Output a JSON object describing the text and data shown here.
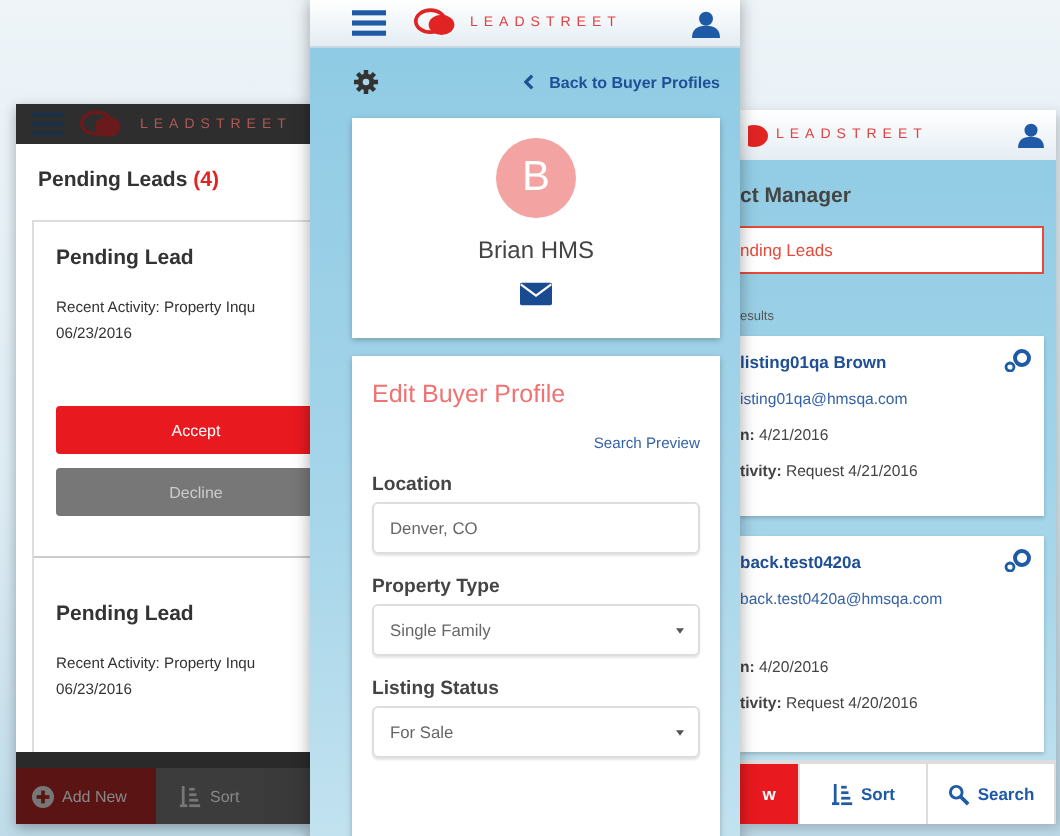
{
  "left_phone": {
    "logo": "LEADSTREET",
    "title": "Pending Leads",
    "count": "(4)",
    "leads": [
      {
        "heading": "Pending Lead",
        "activity": "Recent Activity: Property Inqu",
        "date": "06/23/2016",
        "accept": "Accept",
        "decline": "Decline"
      },
      {
        "heading": "Pending Lead",
        "activity": "Recent Activity: Property Inqu",
        "date": "06/23/2016"
      }
    ],
    "bottom_bar": [
      {
        "kind": "add",
        "label": "Add New"
      },
      {
        "kind": "sort",
        "label": "Sort"
      }
    ]
  },
  "center_phone": {
    "logo": "LEADSTREET",
    "back_link": "Back to Buyer Profiles",
    "avatar_initial": "B",
    "name": "Brian HMS",
    "form": {
      "title": "Edit Buyer Profile",
      "search_preview": "Search Preview",
      "fields": [
        {
          "kind": "text",
          "label": "Location",
          "value": "Denver, CO"
        },
        {
          "kind": "select",
          "label": "Property Type",
          "value": "Single Family"
        },
        {
          "kind": "select",
          "label": "Listing Status",
          "value": "For Sale"
        }
      ]
    }
  },
  "right_phone": {
    "logo": "LEADSTREET",
    "title": "ct Manager",
    "filter": "nding Leads",
    "results_label": "esults",
    "contacts": [
      {
        "name": "listing01qa Brown",
        "email": "isting01qa@hmsqa.com",
        "created": "**n:** 4/21/2016",
        "activity": "**tivity:** Request 4/21/2016"
      },
      {
        "name": "back.test0420a",
        "email": "back.test0420a@hmsqa.com",
        "created": "**n:** 4/20/2016",
        "activity": "**tivity:** Request 4/20/2016"
      }
    ],
    "bottom_bar": [
      {
        "kind": "add",
        "label": "w"
      },
      {
        "kind": "sort",
        "label": "Sort"
      },
      {
        "kind": "search",
        "label": "Search"
      }
    ]
  }
}
